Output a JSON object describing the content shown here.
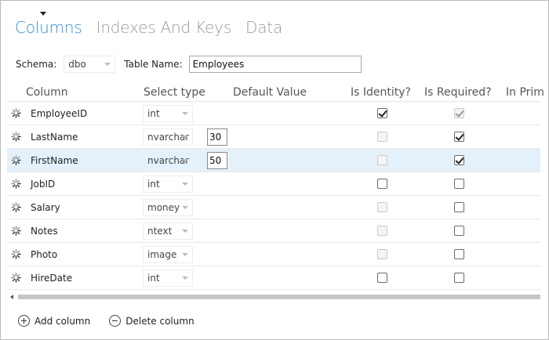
{
  "tabs": [
    {
      "label": "Columns",
      "active": true
    },
    {
      "label": "Indexes And Keys",
      "active": false
    },
    {
      "label": "Data",
      "active": false
    }
  ],
  "schema": {
    "label": "Schema:",
    "value": "dbo"
  },
  "table_name": {
    "label": "Table Name:",
    "value": "Employees"
  },
  "headers": {
    "column": "Column",
    "select_type": "Select type",
    "default_value": "Default Value",
    "is_identity": "Is Identity?",
    "is_required": "Is Required?",
    "in_primary": "In Prim"
  },
  "rows": [
    {
      "name": "EmployeeID",
      "type": "int",
      "length": "",
      "identity": true,
      "identity_enabled": true,
      "required": true,
      "required_enabled": false,
      "selected": false
    },
    {
      "name": "LastName",
      "type": "nvarchar",
      "length": "30",
      "identity": false,
      "identity_enabled": false,
      "required": true,
      "required_enabled": true,
      "selected": false
    },
    {
      "name": "FirstName",
      "type": "nvarchar",
      "length": "50",
      "identity": false,
      "identity_enabled": false,
      "required": true,
      "required_enabled": true,
      "selected": true
    },
    {
      "name": "JobID",
      "type": "int",
      "length": "",
      "identity": false,
      "identity_enabled": true,
      "required": false,
      "required_enabled": true,
      "selected": false
    },
    {
      "name": "Salary",
      "type": "money",
      "length": "",
      "identity": false,
      "identity_enabled": false,
      "required": false,
      "required_enabled": true,
      "selected": false
    },
    {
      "name": "Notes",
      "type": "ntext",
      "length": "",
      "identity": false,
      "identity_enabled": false,
      "required": false,
      "required_enabled": true,
      "selected": false
    },
    {
      "name": "Photo",
      "type": "image",
      "length": "",
      "identity": false,
      "identity_enabled": false,
      "required": false,
      "required_enabled": true,
      "selected": false
    },
    {
      "name": "HireDate",
      "type": "int",
      "length": "",
      "identity": false,
      "identity_enabled": true,
      "required": false,
      "required_enabled": true,
      "selected": false
    }
  ],
  "actions": {
    "add": "Add column",
    "delete": "Delete column"
  },
  "icons": {
    "row_handle": "spinner-handle-icon",
    "add": "plus-circle-icon",
    "delete": "minus-circle-icon"
  },
  "colors": {
    "accent": "#2f8fd8",
    "selected_row": "#e4f1fb"
  }
}
